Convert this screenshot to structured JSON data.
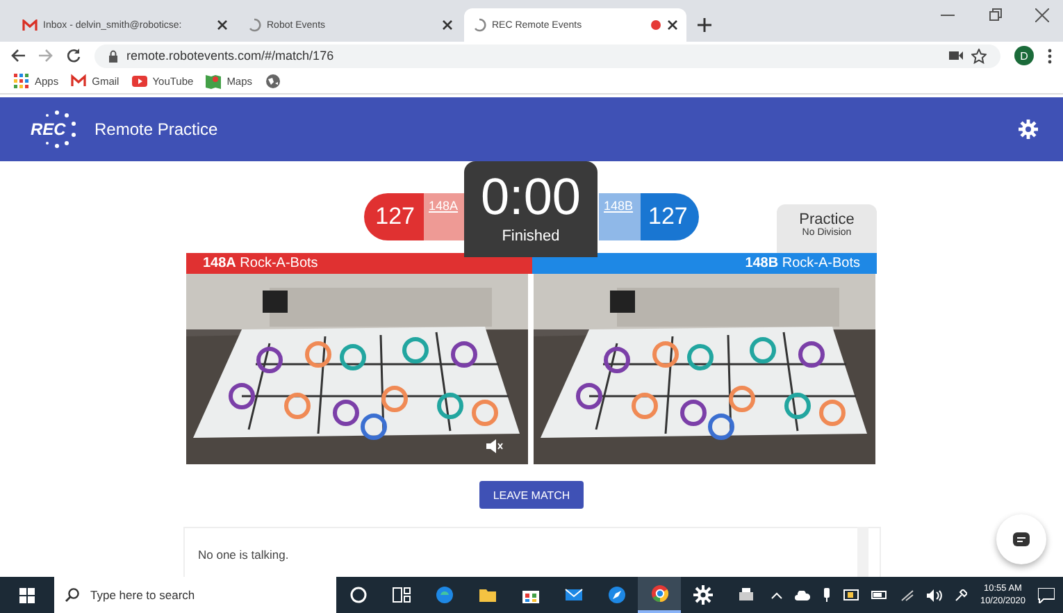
{
  "browser": {
    "tabs": [
      {
        "kind": "mail",
        "title": "Inbox - delvin_smith@roboticse:",
        "selected": false
      },
      {
        "kind": "loading",
        "title": "Robot Events",
        "selected": false
      },
      {
        "kind": "loading",
        "title": "REC Remote Events",
        "selected": true,
        "recording": true
      }
    ],
    "address": "remote.robotevents.com/#/match/176",
    "profile": "D",
    "bookmarks": [
      {
        "kind": "apps",
        "label": "Apps"
      },
      {
        "kind": "mail",
        "label": "Gmail"
      },
      {
        "kind": "video",
        "label": "YouTube"
      },
      {
        "kind": "maps",
        "label": "Maps"
      },
      {
        "kind": "globe"
      }
    ]
  },
  "app": {
    "logo": "REC",
    "title": "Remote Practice",
    "score": {
      "red": {
        "score": "127",
        "team": "148A"
      },
      "blue": {
        "score": "127",
        "team": "148B"
      }
    },
    "timer": {
      "time": "0:00",
      "status": "Finished"
    },
    "division": {
      "title": "Practice",
      "subtitle": "No Division"
    },
    "teams": [
      {
        "kind": "red",
        "label": "**148A** Rock-A-Bots"
      },
      {
        "kind": "blue",
        "label": "**148B** Rock-A-Bots"
      }
    ],
    "videos": [
      {
        "kind": "picture",
        "muted": true
      },
      {
        "kind": "picture",
        "muted": false
      }
    ],
    "button": "LEAVE MATCH",
    "chat": {
      "message": "No one is talking."
    }
  },
  "taskbar": {
    "search": {
      "placeholder": "Type here to search"
    },
    "apps": [
      {
        "kind": "cortana",
        "selected": false
      },
      {
        "kind": "taskview",
        "selected": false
      },
      {
        "kind": "edge",
        "selected": false
      },
      {
        "kind": "folder",
        "selected": false
      },
      {
        "kind": "store",
        "selected": false
      },
      {
        "kind": "mail",
        "selected": false
      },
      {
        "kind": "compass",
        "selected": false
      },
      {
        "kind": "chrome",
        "selected": true
      },
      {
        "kind": "gear",
        "selected": false
      },
      {
        "kind": "printer",
        "selected": false
      }
    ],
    "time": "10:55 AM",
    "date": "10/20/2020"
  }
}
